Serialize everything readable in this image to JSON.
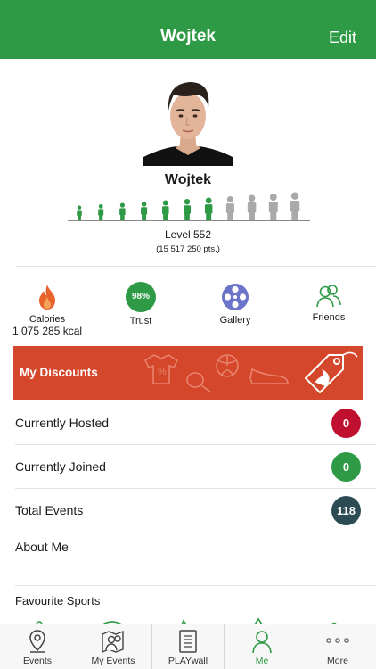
{
  "header": {
    "title": "Wojtek",
    "edit_label": "Edit"
  },
  "profile": {
    "name": "Wojtek",
    "level_text": "Level 552",
    "points_text": "(15 517 250 pts.)",
    "level_figures_total": 11,
    "level_figures_achieved": 7
  },
  "stats": {
    "calories_label": "Calories",
    "calories_value": "1 075 285 kcal",
    "trust_value": "98%",
    "trust_label": "Trust",
    "gallery_label": "Gallery",
    "friends_label": "Friends"
  },
  "discounts": {
    "label": "My Discounts"
  },
  "rows": [
    {
      "label": "Currently Hosted",
      "count": "0",
      "color": "#c0102f"
    },
    {
      "label": "Currently Joined",
      "count": "0",
      "color": "#2e9a46"
    },
    {
      "label": "Total Events",
      "count": "118",
      "color": "#2d4b55"
    }
  ],
  "about_label": "About Me",
  "favourite_label": "Favourite Sports",
  "tabs": [
    {
      "label": "Events",
      "icon": "map-pin-icon"
    },
    {
      "label": "My Events",
      "icon": "map-people-icon"
    },
    {
      "label": "PLAYwall",
      "icon": "document-icon"
    },
    {
      "label": "Me",
      "icon": "person-icon"
    },
    {
      "label": "More",
      "icon": "more-dots-icon"
    }
  ],
  "colors": {
    "brand_green": "#2e9a46",
    "discount_orange": "#d4472b",
    "gallery_blue": "#6b74c9",
    "flame_orange": "#e8622b",
    "inactive_gray": "#a9a9a9"
  }
}
